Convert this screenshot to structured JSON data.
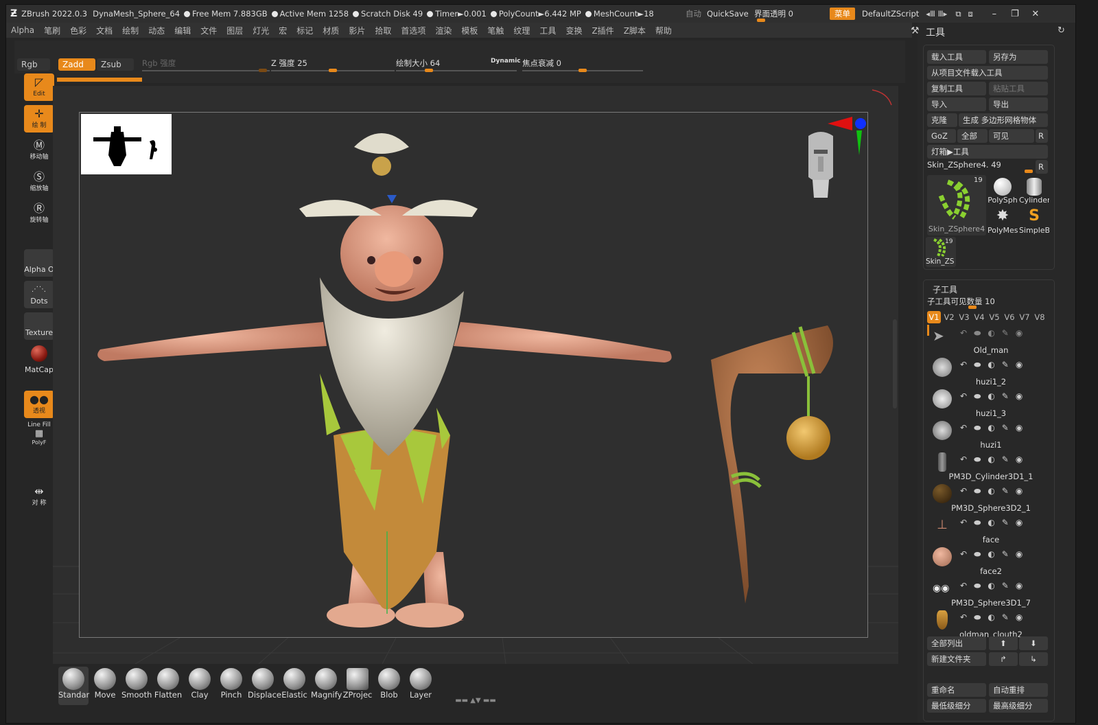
{
  "titlebar": {
    "app": "ZBrush 2022.0.3",
    "document": "DynaMesh_Sphere_64",
    "free_mem": "Free Mem 7.883GB",
    "active_mem": "Active Mem 1258",
    "scratch_disk": "Scratch Disk 49",
    "timer": "Timer►0.001",
    "polycount": "PolyCount►6.442 MP",
    "meshcount": "MeshCount►18",
    "auto": "自动",
    "quicksave": "QuickSave",
    "transparency": "界面透明 0",
    "menu": "菜单",
    "script": "DefaultZScript"
  },
  "menubar": [
    "Alpha",
    "笔刷",
    "色彩",
    "文档",
    "绘制",
    "动态",
    "编辑",
    "文件",
    "图层",
    "灯光",
    "宏",
    "标记",
    "材质",
    "影片",
    "拾取",
    "首选项",
    "渲染",
    "模板",
    "笔触",
    "纹理",
    "工具",
    "变换",
    "Z插件",
    "Z脚本",
    "帮助"
  ],
  "brushbar": {
    "rgb": "Rgb",
    "zadd": "Zadd",
    "zsub": "Zsub",
    "rgb_intensity": "Rgb 强度",
    "z_intensity": "Z 强度 25",
    "draw_size": "绘制大小 64",
    "dynamic": "Dynamic",
    "focal_shift": "焦点衰减 0"
  },
  "leftshelf": {
    "edit": "Edit",
    "draw": "绘 制",
    "move": "移动轴",
    "scale": "缩放轴",
    "rotate": "旋转轴",
    "alpha": "Alpha O",
    "dots": "Dots",
    "texture": "Texture",
    "matcap": "MatCap",
    "floor": "透视",
    "linefill": "Line Fill",
    "polyf": "PolyF",
    "symmetry": "对 称"
  },
  "brushes": [
    "Standar",
    "Move",
    "Smooth",
    "Flatten",
    "Clay",
    "Pinch",
    "Displace",
    "Elastic",
    "Magnify",
    "ZProjec",
    "Blob",
    "Layer"
  ],
  "rpanel": {
    "title": "工具",
    "load_tool": "载入工具",
    "save_as": "另存为",
    "load_from_project": "从项目文件载入工具",
    "copy_tool": "复制工具",
    "paste_tool": "粘贴工具",
    "import": "导入",
    "export": "导出",
    "clone": "克隆",
    "make_polymesh": "生成 多边形网格物体",
    "goz": "GoZ",
    "all": "全部",
    "visible": "可见",
    "r": "R",
    "lightbox_tools": "灯箱▶工具",
    "current_tool": "Skin_ZSphere4. 49",
    "thumb_count": "19",
    "thumb_main": "Skin_ZSphere4",
    "thumb_polysph": "PolySph",
    "thumb_cylinder": "Cylinder",
    "thumb_polymesh": "PolyMes",
    "thumb_simple": "SimpleB",
    "thumb_small": "Skin_ZS",
    "thumb_small_count": "19",
    "subtool_title": "子工具",
    "visible_count": "子工具可见数量 10",
    "vtabs": [
      "V1",
      "V2",
      "V3",
      "V4",
      "V5",
      "V6",
      "V7",
      "V8"
    ],
    "subtools": [
      "Old_man",
      "huzi1_2",
      "huzi1_3",
      "huzi1",
      "PM3D_Cylinder3D1_1",
      "PM3D_Sphere3D2_1",
      "face",
      "face2",
      "PM3D_Sphere3D1_7",
      "oldman_clouth2"
    ],
    "list_all": "全部列出",
    "new_folder": "新建文件夹",
    "rename": "重命名",
    "auto_reorder": "自动重排",
    "lowest_sub": "最低级细分",
    "highest_sub": "最高级细分"
  },
  "colors": {
    "accent": "#e8891b",
    "panel": "#282828",
    "viewport": "#2e2e2e"
  }
}
